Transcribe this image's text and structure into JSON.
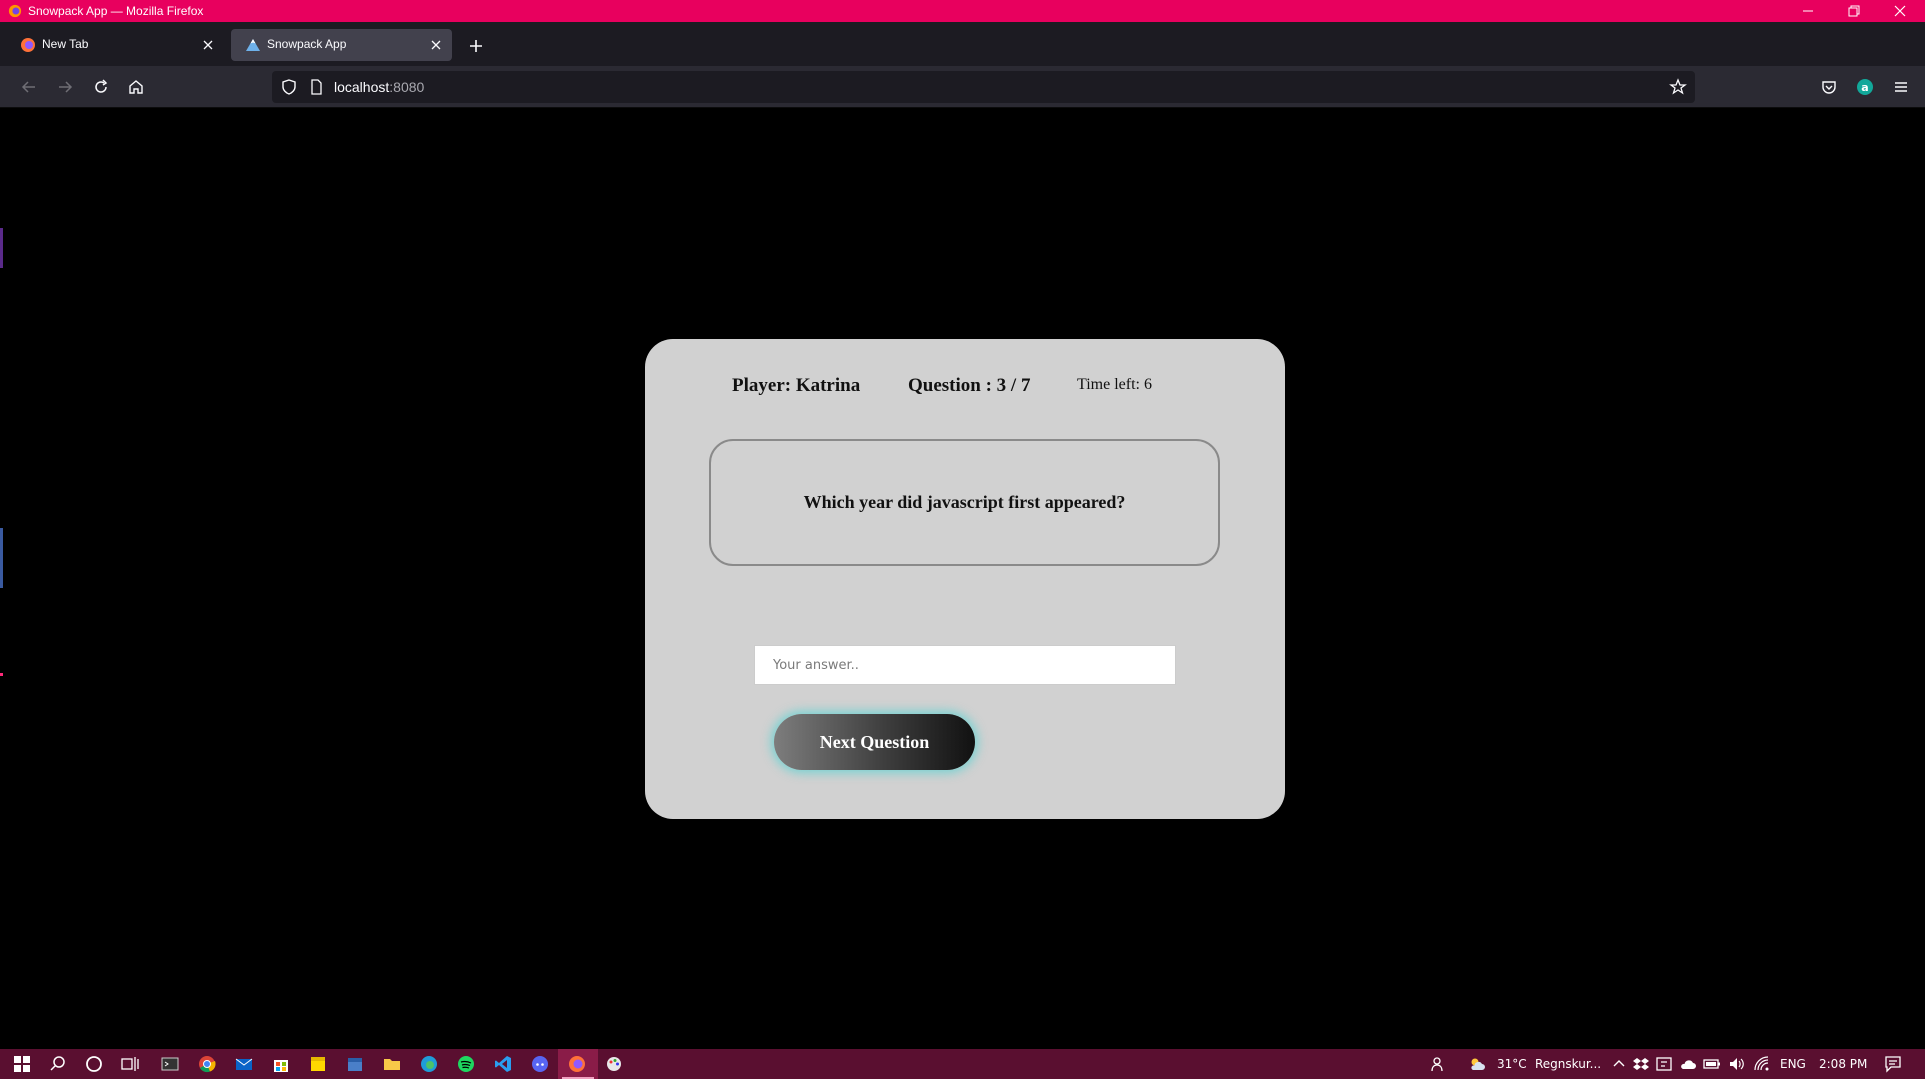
{
  "window": {
    "title": "Snowpack App — Mozilla Firefox"
  },
  "tabs": [
    {
      "label": "New Tab",
      "icon": "firefox-icon",
      "active": false
    },
    {
      "label": "Snowpack App",
      "icon": "snowpack-icon",
      "active": true
    }
  ],
  "navbar": {
    "url_host": "localhost",
    "url_port": ":8080"
  },
  "quiz": {
    "player": "Player: Katrina",
    "question_count": "Question : 3 / 7",
    "time_left": "Time left: 6",
    "question": "Which year did javascript first appeared?",
    "answer_placeholder": "Your answer..",
    "answer_value": "",
    "next_button": "Next Question"
  },
  "taskbar": {
    "weather": "31°C",
    "weather_desc": "Regnskur...",
    "language": "ENG",
    "time": "2:08 PM"
  },
  "colors": {
    "titlebar": "#e8005e",
    "card": "#d1d1d1",
    "button_glow": "#5ad2d2"
  }
}
